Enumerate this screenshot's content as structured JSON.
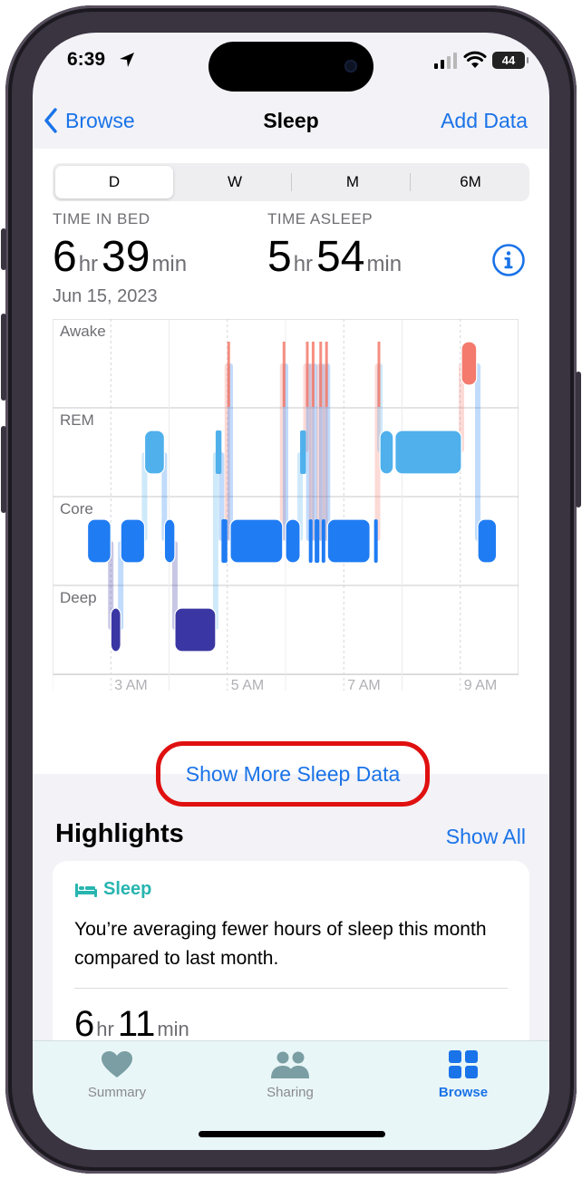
{
  "status": {
    "time": "6:39",
    "battery": "44"
  },
  "nav": {
    "back_label": "Browse",
    "title": "Sleep",
    "add_label": "Add Data"
  },
  "segments": [
    "D",
    "W",
    "M",
    "6M"
  ],
  "metrics": {
    "in_bed_label": "TIME IN BED",
    "in_bed_hr": "6",
    "in_bed_min": "39",
    "asleep_label": "TIME ASLEEP",
    "asleep_hr": "5",
    "asleep_min": "54",
    "unit_hr": "hr",
    "unit_min": "min"
  },
  "date": "Jun 15, 2023",
  "chart_data": {
    "type": "sleep-stages",
    "stages": [
      "Awake",
      "REM",
      "Core",
      "Deep"
    ],
    "x_ticks": [
      "3 AM",
      "5 AM",
      "7 AM",
      "9 AM"
    ],
    "x_range_hours": [
      2.0,
      10.0
    ],
    "colors": {
      "Awake": "#f37a6c",
      "REM": "#4fb0ec",
      "Core": "#1f7cf3",
      "Deep": "#3a36a3"
    },
    "segments": [
      {
        "stage": "Core",
        "start": 2.6,
        "end": 3.0
      },
      {
        "stage": "Deep",
        "start": 3.0,
        "end": 3.17
      },
      {
        "stage": "Core",
        "start": 3.17,
        "end": 3.58
      },
      {
        "stage": "REM",
        "start": 3.58,
        "end": 3.92
      },
      {
        "stage": "Core",
        "start": 3.92,
        "end": 4.1
      },
      {
        "stage": "Deep",
        "start": 4.1,
        "end": 4.8
      },
      {
        "stage": "REM",
        "start": 4.8,
        "end": 4.9
      },
      {
        "stage": "Core",
        "start": 4.9,
        "end": 5.0
      },
      {
        "stage": "Awake",
        "start": 5.0,
        "end": 5.05
      },
      {
        "stage": "Core",
        "start": 5.05,
        "end": 5.95
      },
      {
        "stage": "Awake",
        "start": 5.95,
        "end": 6.0
      },
      {
        "stage": "Core",
        "start": 6.0,
        "end": 6.25
      },
      {
        "stage": "REM",
        "start": 6.25,
        "end": 6.35
      },
      {
        "stage": "Awake",
        "start": 6.35,
        "end": 6.4
      },
      {
        "stage": "Core",
        "start": 6.4,
        "end": 6.45
      },
      {
        "stage": "Awake",
        "start": 6.45,
        "end": 6.5
      },
      {
        "stage": "Core",
        "start": 6.5,
        "end": 6.58
      },
      {
        "stage": "Awake",
        "start": 6.58,
        "end": 6.62
      },
      {
        "stage": "Core",
        "start": 6.62,
        "end": 6.68
      },
      {
        "stage": "Awake",
        "start": 6.68,
        "end": 6.72
      },
      {
        "stage": "Core",
        "start": 6.72,
        "end": 7.45
      },
      {
        "stage": "Core",
        "start": 7.52,
        "end": 7.58
      },
      {
        "stage": "Awake",
        "start": 7.58,
        "end": 7.62
      },
      {
        "stage": "REM",
        "start": 7.62,
        "end": 7.85
      },
      {
        "stage": "REM",
        "start": 7.88,
        "end": 9.02
      },
      {
        "stage": "Awake",
        "start": 9.02,
        "end": 9.28
      },
      {
        "stage": "Core",
        "start": 9.3,
        "end": 9.62
      }
    ]
  },
  "more_button": "Show More Sleep Data",
  "highlights": {
    "title": "Highlights",
    "show_all": "Show All",
    "card_category": "Sleep",
    "card_text": "You’re averaging fewer hours of sleep this month compared to last month.",
    "avg_hr": "6",
    "avg_min": "11"
  },
  "tabs": [
    {
      "label": "Summary",
      "icon": "heart-icon"
    },
    {
      "label": "Sharing",
      "icon": "people-icon"
    },
    {
      "label": "Browse",
      "icon": "grid-icon"
    }
  ]
}
